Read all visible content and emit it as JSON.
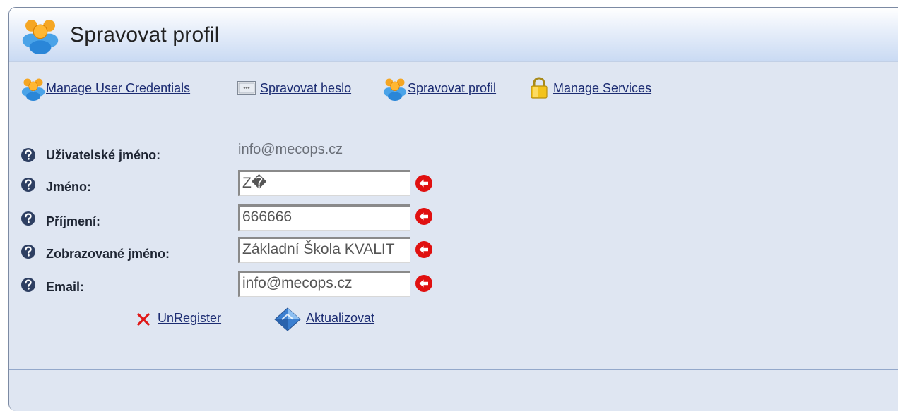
{
  "header": {
    "title": "Spravovat profil",
    "icon": "users-icon"
  },
  "nav": {
    "items": [
      {
        "label": "Manage User Credentials",
        "icon": "users-icon"
      },
      {
        "label": "Spravovat heslo",
        "icon": "password-field-icon"
      },
      {
        "label": "Spravovat profil",
        "icon": "users-icon"
      },
      {
        "label": "Manage Services",
        "icon": "lock-icon"
      }
    ]
  },
  "form": {
    "username_label": "Uživatelské jméno:",
    "username_value": "info@mecops.cz",
    "first_name_label": "Jméno:",
    "first_name_value": "Z�",
    "last_name_label": "Příjmení:",
    "last_name_value": "666666",
    "display_name_label": "Zobrazované jméno:",
    "display_name_value": "Základní Škola KVALIT",
    "email_label": "Email:",
    "email_value": "info@mecops.cz"
  },
  "actions": {
    "unregister_label": "UnRegister",
    "update_label": "Aktualizovat"
  },
  "colors": {
    "link": "#1c2c72",
    "required": "#e01010",
    "panel": "#dfe6f2",
    "header_gradient_end": "#c9daf3"
  }
}
